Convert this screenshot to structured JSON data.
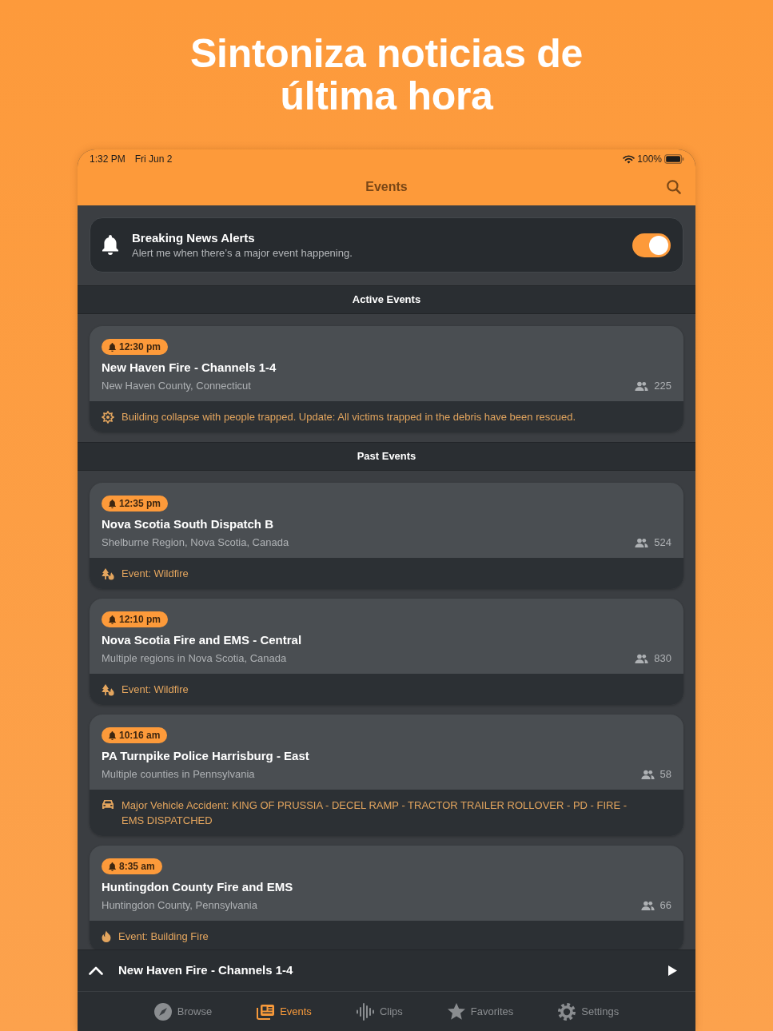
{
  "headline": "Sintoniza noticias de última hora",
  "status_bar": {
    "time": "1:32 PM",
    "date": "Fri Jun 2",
    "battery": "100%"
  },
  "nav_bar": {
    "title": "Events"
  },
  "alerts": {
    "title": "Breaking News Alerts",
    "subtitle": "Alert me when there’s a major event happening.",
    "on": true
  },
  "sections": [
    {
      "title": "Active Events",
      "events": [
        {
          "time": "12:30 pm",
          "title": "New Haven Fire - Channels 1-4",
          "location": "New Haven County, Connecticut",
          "listeners": "225",
          "kind": "collapse",
          "description": "Building collapse with people trapped. Update: All victims trapped in the debris have been rescued."
        }
      ]
    },
    {
      "title": "Past Events",
      "events": [
        {
          "time": "12:35 pm",
          "title": "Nova Scotia South Dispatch B",
          "location": "Shelburne Region, Nova Scotia, Canada",
          "listeners": "524",
          "kind": "wildfire",
          "description": "Event: Wildfire"
        },
        {
          "time": "12:10 pm",
          "title": "Nova Scotia Fire and EMS - Central",
          "location": "Multiple regions in Nova Scotia, Canada",
          "listeners": "830",
          "kind": "wildfire",
          "description": "Event: Wildfire"
        },
        {
          "time": "10:16 am",
          "title": "PA Turnpike Police Harrisburg - East",
          "location": "Multiple counties in Pennsylvania",
          "listeners": "58",
          "kind": "vehicle",
          "description": "Major Vehicle Accident: KING OF PRUSSIA - DECEL RAMP - TRACTOR TRAILER ROLLOVER - PD - FIRE - EMS DISPATCHED"
        },
        {
          "time": "8:35 am",
          "title": "Huntingdon County Fire and EMS",
          "location": "Huntingdon County, Pennsylvania",
          "listeners": "66",
          "kind": "fire",
          "description": "Event: Building Fire"
        }
      ]
    }
  ],
  "player": {
    "title": "New Haven Fire - Channels 1-4"
  },
  "tab_bar": [
    {
      "label": "Browse",
      "selected": false
    },
    {
      "label": "Events",
      "selected": true
    },
    {
      "label": "Clips",
      "selected": false
    },
    {
      "label": "Favorites",
      "selected": false
    },
    {
      "label": "Settings",
      "selected": false
    }
  ]
}
